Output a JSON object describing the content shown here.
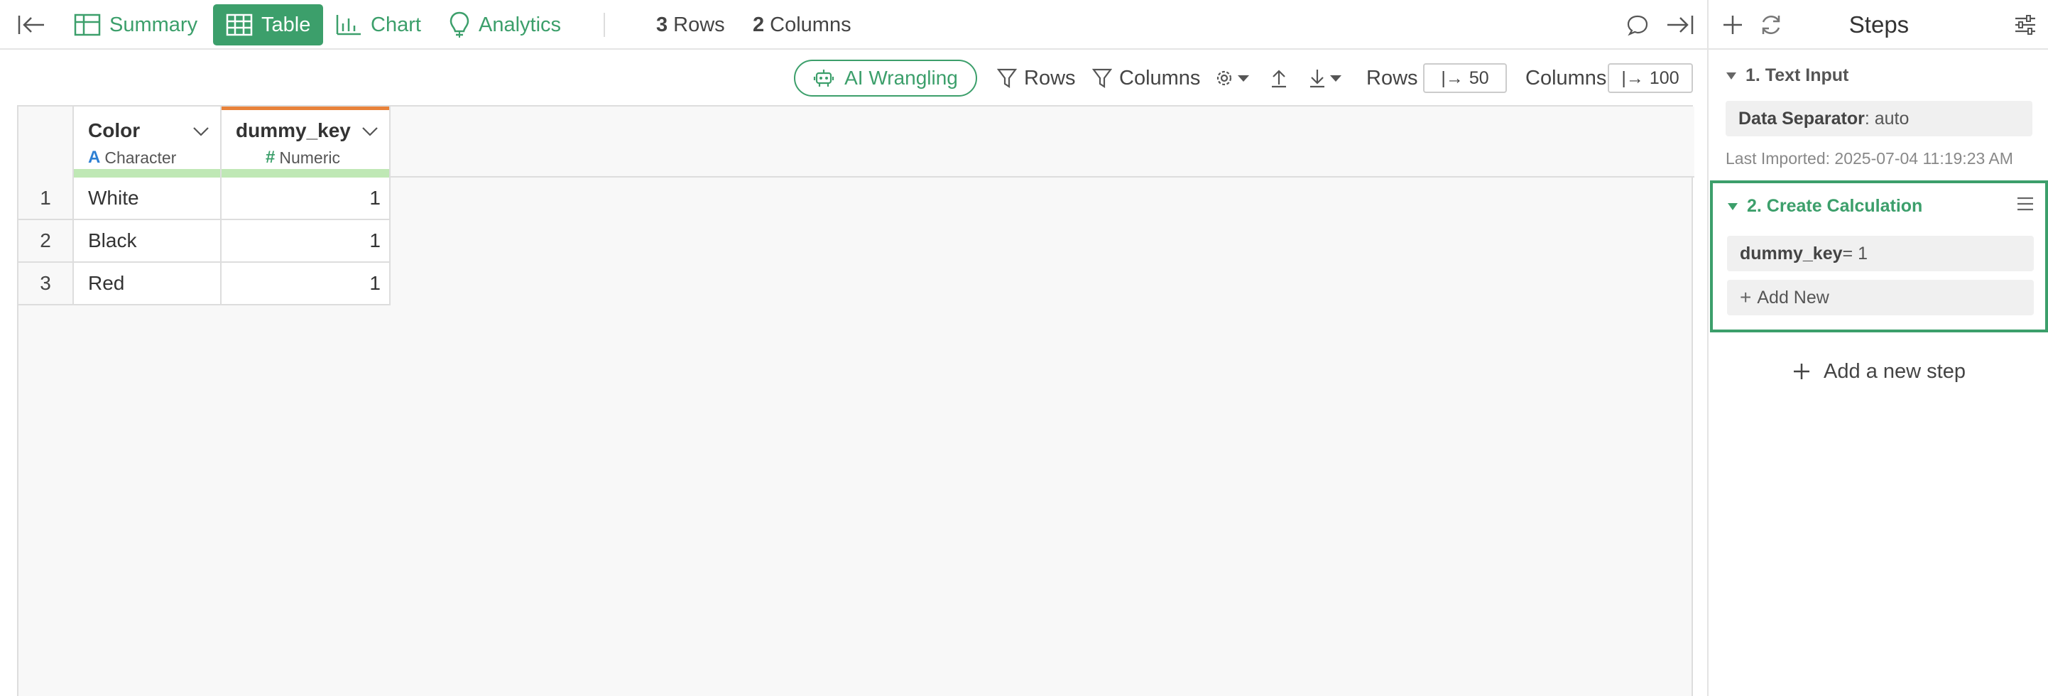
{
  "topbar": {
    "tabs": [
      {
        "label": "Summary",
        "icon": "summary-grid-icon"
      },
      {
        "label": "Table",
        "icon": "table-icon",
        "active": true
      },
      {
        "label": "Chart",
        "icon": "bar-chart-icon"
      },
      {
        "label": "Analytics",
        "icon": "lightbulb-icon"
      }
    ],
    "rows_count": "3",
    "rows_label": "Rows",
    "cols_count": "2",
    "cols_label": "Columns"
  },
  "toolbar": {
    "ai_label": "AI Wrangling",
    "rows_filter_label": "Rows",
    "columns_filter_label": "Columns",
    "rows_limit_label": "Rows",
    "rows_limit_value": "50",
    "columns_limit_label": "Columns",
    "columns_limit_value": "100"
  },
  "table": {
    "columns": [
      {
        "name": "Color",
        "type": "Character",
        "type_icon": "A"
      },
      {
        "name": "dummy_key",
        "type": "Numeric",
        "type_icon": "#"
      }
    ],
    "rows": [
      {
        "num": "1",
        "color": "White",
        "dummy_key": "1"
      },
      {
        "num": "2",
        "color": "Black",
        "dummy_key": "1"
      },
      {
        "num": "3",
        "color": "Red",
        "dummy_key": "1"
      }
    ]
  },
  "steps_panel": {
    "title": "Steps",
    "step1": {
      "title": "1. Text Input",
      "param_key": "Data Separator",
      "param_value": ": auto",
      "last_imported": "Last Imported: 2025-07-04 11:19:23 AM"
    },
    "step2": {
      "title": "2. Create Calculation",
      "calc_key": "dummy_key",
      "calc_value": " = 1",
      "add_new": "Add New"
    },
    "add_step": "Add a new step"
  },
  "colors": {
    "accent": "#3c9f6b",
    "header_highlight": "#e8823a",
    "quality_bar": "#bfe8b5"
  }
}
